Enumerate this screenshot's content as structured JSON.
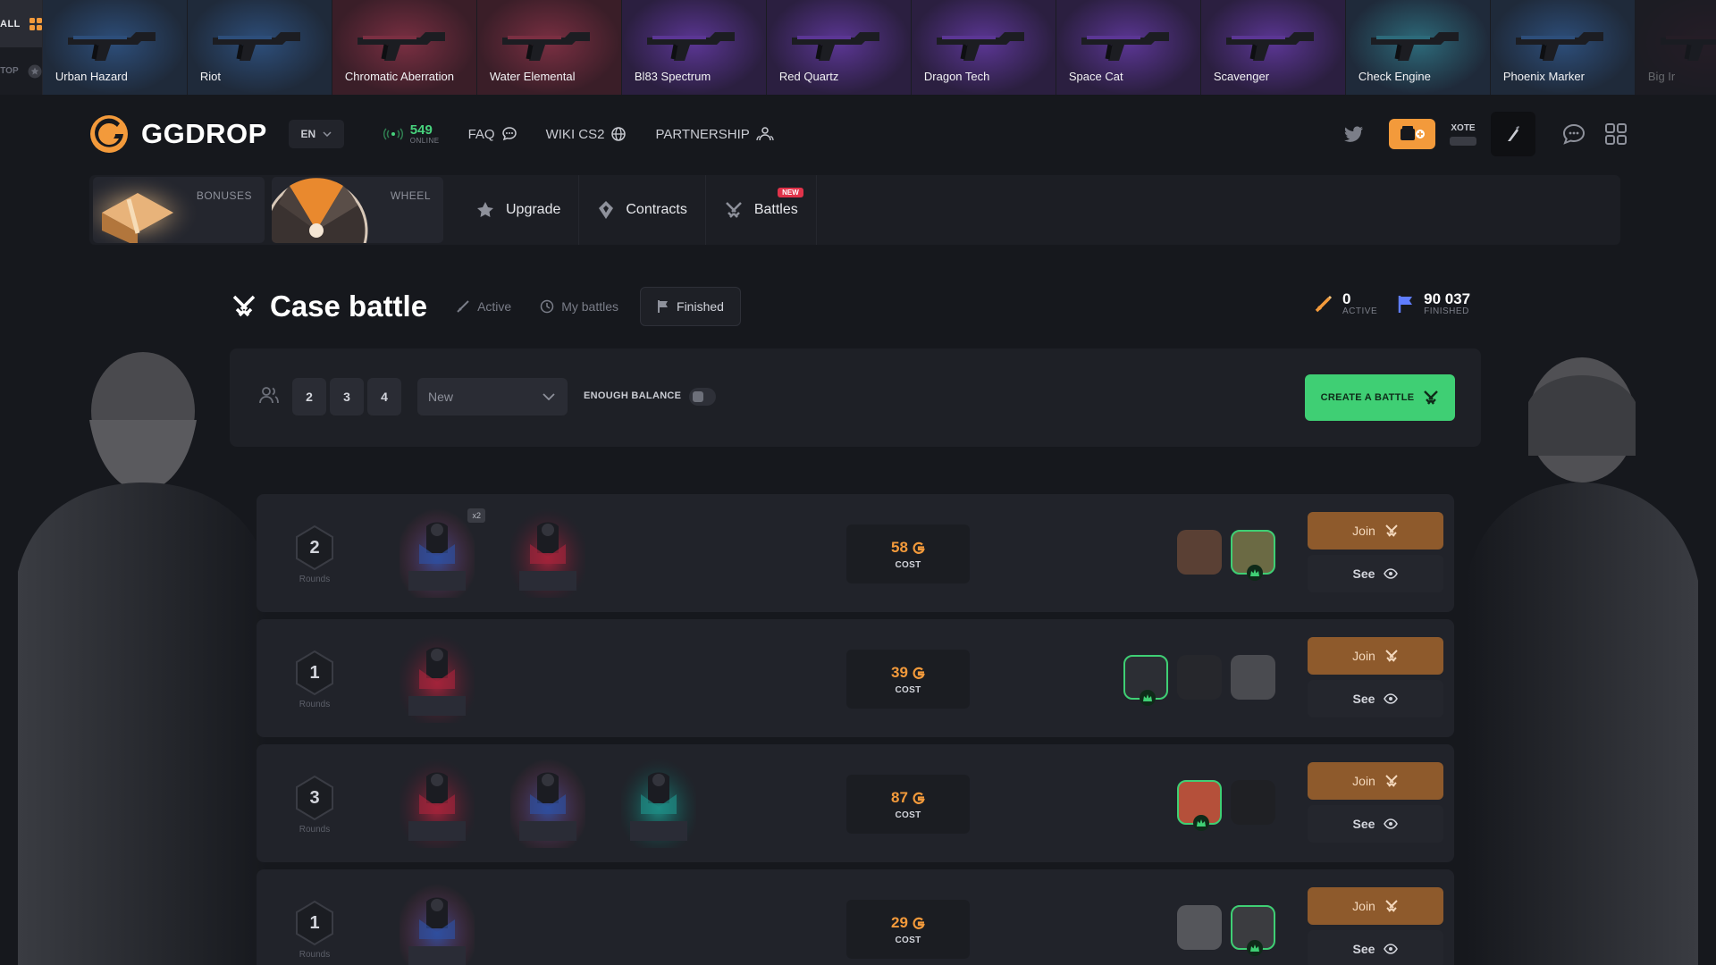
{
  "drops": {
    "all_label": "ALL",
    "top_label": "TOP",
    "items": [
      {
        "name": "Urban Hazard",
        "bg": "#1f2a3a",
        "glow": "#2d4e7a"
      },
      {
        "name": "Riot",
        "bg": "#1f2a3a",
        "glow": "#2d4e7a"
      },
      {
        "name": "Chromatic Aberration",
        "bg": "#3a1e28",
        "glow": "#7a2f42"
      },
      {
        "name": "Water Elemental",
        "bg": "#3a1e28",
        "glow": "#7a2f42"
      },
      {
        "name": "Bl83 Spectrum",
        "bg": "#2b1f40",
        "glow": "#5b3694"
      },
      {
        "name": "Red Quartz",
        "bg": "#2b1f40",
        "glow": "#5b3694"
      },
      {
        "name": "Dragon Tech",
        "bg": "#2b1f40",
        "glow": "#5b3694"
      },
      {
        "name": "Space Cat",
        "bg": "#2b1f40",
        "glow": "#5b3694"
      },
      {
        "name": "Scavenger",
        "bg": "#2b1f40",
        "glow": "#5b3694"
      },
      {
        "name": "Check Engine",
        "bg": "#1f2a3a",
        "glow": "#2d6a7a"
      },
      {
        "name": "Phoenix Marker",
        "bg": "#1f2a3a",
        "glow": "#2d4e7a"
      },
      {
        "name": "Big Ir",
        "bg": "#221c26",
        "glow": "#3a2030"
      }
    ]
  },
  "header": {
    "brand": "GGDROP",
    "lang": "EN",
    "online_count": "549",
    "online_label": "ONLINE",
    "faq": "FAQ",
    "wiki": "WIKI CS2",
    "partnership": "PARTNERSHIP",
    "username": "XOTE"
  },
  "menu": {
    "bonuses": "BONUSES",
    "wheel": "WHEEL",
    "upgrade": "Upgrade",
    "contracts": "Contracts",
    "battles": "Battles",
    "new_badge": "NEW"
  },
  "page": {
    "title": "Case battle",
    "tab_active": "Active",
    "tab_my": "My battles",
    "tab_finished": "Finished",
    "stat_active_value": "0",
    "stat_active_label": "ACTIVE",
    "stat_finished_value": "90 037",
    "stat_finished_label": "FINISHED"
  },
  "filters": {
    "player_counts": [
      "2",
      "3",
      "4"
    ],
    "sort_value": "New",
    "enough_balance": "ENOUGH BALANCE",
    "create": "CREATE A BATTLE"
  },
  "battles": {
    "rounds_label": "Rounds",
    "cost_label": "COST",
    "join_label": "Join",
    "see_label": "See",
    "multiplier": "x2",
    "rows": [
      {
        "rounds": "2",
        "cost": "58",
        "cases": [
          "blue",
          "red"
        ],
        "players": [
          {
            "c": "#5a4034",
            "w": false
          },
          {
            "c": "#6b6a44",
            "w": true
          }
        ]
      },
      {
        "rounds": "1",
        "cost": "39",
        "cases": [
          "red"
        ],
        "players": [
          {
            "c": "#2c2e34",
            "w": true
          },
          {
            "c": "#26272c",
            "w": false
          },
          {
            "c": "#4a4b50",
            "w": false
          }
        ]
      },
      {
        "rounds": "3",
        "cost": "87",
        "cases": [
          "red",
          "blue",
          "teal"
        ],
        "players": [
          {
            "c": "#b5503a",
            "w": true
          },
          {
            "c": "#1f2024",
            "w": false
          }
        ]
      },
      {
        "rounds": "1",
        "cost": "29",
        "cases": [
          "blue"
        ],
        "players": [
          {
            "c": "#55565b",
            "w": false
          },
          {
            "c": "#3b3c40",
            "w": true
          }
        ]
      }
    ]
  },
  "colors": {
    "accent_orange": "#f39a3b",
    "accent_green": "#3fcf74",
    "online_green": "#47d17c"
  },
  "icons": {
    "all": "grid-icon",
    "top": "star-icon",
    "online": "radio-wave-icon",
    "faq": "chat-bubble-icon",
    "wiki": "globe-icon",
    "partnership": "people-icon",
    "twitter": "twitter-icon",
    "battle": "crossed-swords-icon",
    "see": "eye-icon"
  }
}
